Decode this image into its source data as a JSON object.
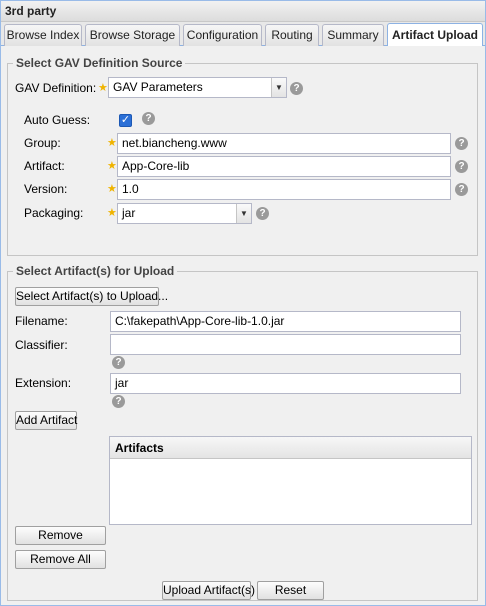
{
  "window": {
    "title": "3rd party"
  },
  "tabs": [
    {
      "label": "Browse Index"
    },
    {
      "label": "Browse Storage"
    },
    {
      "label": "Configuration"
    },
    {
      "label": "Routing"
    },
    {
      "label": "Summary"
    },
    {
      "label": "Artifact Upload",
      "active": true
    }
  ],
  "gav_section": {
    "legend": "Select GAV Definition Source",
    "gav_definition": {
      "label": "GAV Definition:",
      "value": "GAV Parameters"
    },
    "auto_guess": {
      "label": "Auto Guess:",
      "checked": true
    },
    "group": {
      "label": "Group:",
      "value": "net.biancheng.www"
    },
    "artifact": {
      "label": "Artifact:",
      "value": "App-Core-lib"
    },
    "version": {
      "label": "Version:",
      "value": "1.0"
    },
    "packaging": {
      "label": "Packaging:",
      "value": "jar"
    }
  },
  "upload_section": {
    "legend": "Select Artifact(s) for Upload",
    "select_button": "Select Artifact(s) to Upload...",
    "filename": {
      "label": "Filename:",
      "value": "C:\\fakepath\\App-Core-lib-1.0.jar"
    },
    "classifier": {
      "label": "Classifier:",
      "value": ""
    },
    "extension": {
      "label": "Extension:",
      "value": "jar"
    },
    "add_button": "Add Artifact",
    "artifacts_grid": {
      "header": "Artifacts",
      "rows": []
    },
    "remove_button": "Remove",
    "remove_all_button": "Remove All"
  },
  "footer": {
    "upload_button": "Upload Artifact(s)",
    "reset_button": "Reset"
  },
  "icons": {
    "help": "help-icon",
    "required": "required-star-icon",
    "dropdown": "chevron-down-icon",
    "check": "checkmark-icon"
  },
  "colors": {
    "active_tab_border": "#8db2e3",
    "required_star": "#f0b400",
    "checkbox": "#2b6fd6",
    "help_icon": "#9a9a9a"
  }
}
